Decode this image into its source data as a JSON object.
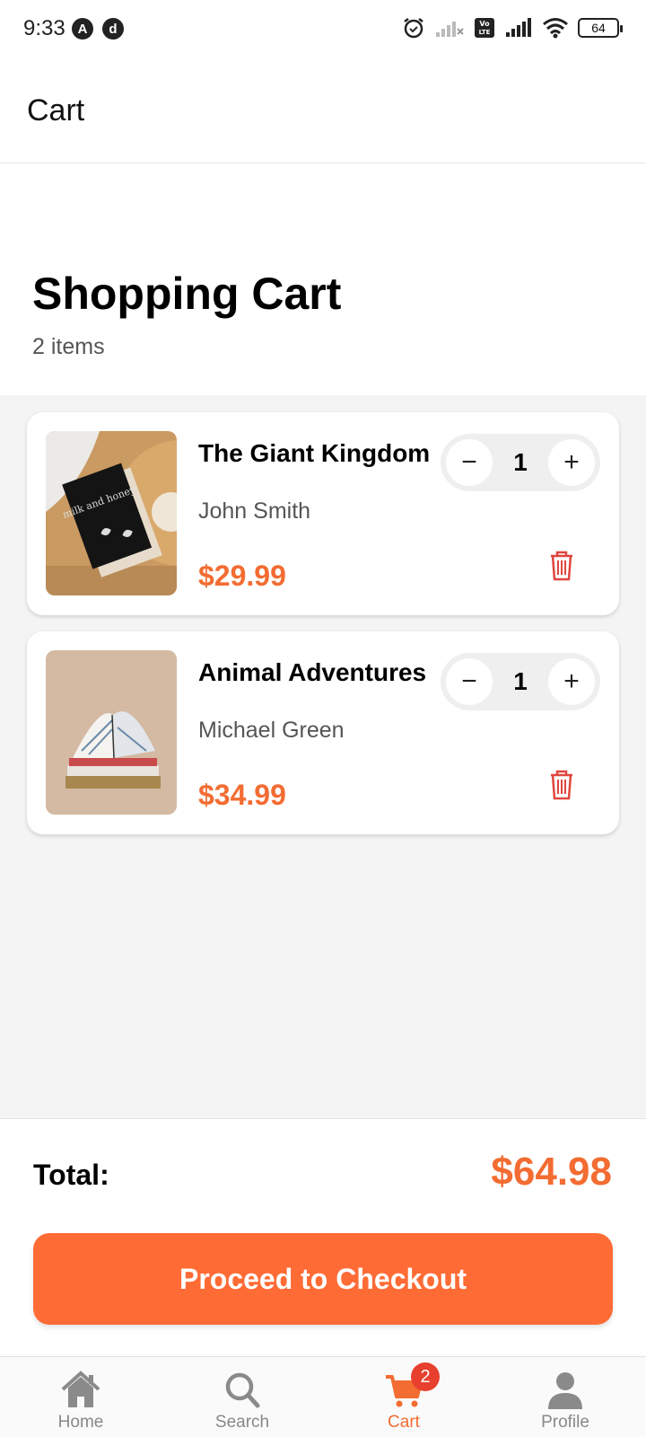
{
  "status_bar": {
    "time": "9:33",
    "notif_icons": [
      "A",
      "d"
    ],
    "battery": "64",
    "network_badge": "Vo LTE"
  },
  "app_bar": {
    "title": "Cart"
  },
  "header": {
    "heading": "Shopping Cart",
    "item_count": "2 items"
  },
  "items": [
    {
      "title": "The Giant Kingdom",
      "author": "John Smith",
      "price": "$29.99",
      "quantity": "1",
      "image": "book-milk-and-honey-photo",
      "book_cover_text": "milk and honey"
    },
    {
      "title": "Animal Adventures",
      "author": "Michael Green",
      "price": "$34.99",
      "quantity": "1",
      "image": "open-book-stack-photo"
    }
  ],
  "controls": {
    "minus": "−",
    "plus": "+"
  },
  "footer": {
    "total_label": "Total:",
    "total_value": "$64.98",
    "checkout_label": "Proceed to Checkout"
  },
  "nav": {
    "items": [
      {
        "label": "Home",
        "icon": "home-icon"
      },
      {
        "label": "Search",
        "icon": "search-icon"
      },
      {
        "label": "Cart",
        "icon": "cart-icon",
        "badge": "2"
      },
      {
        "label": "Profile",
        "icon": "profile-icon"
      }
    ],
    "active_index": 2
  },
  "colors": {
    "accent": "#ff6b35",
    "price": "#f36c32",
    "badge": "#e8402f",
    "trash": "#e0463e"
  }
}
